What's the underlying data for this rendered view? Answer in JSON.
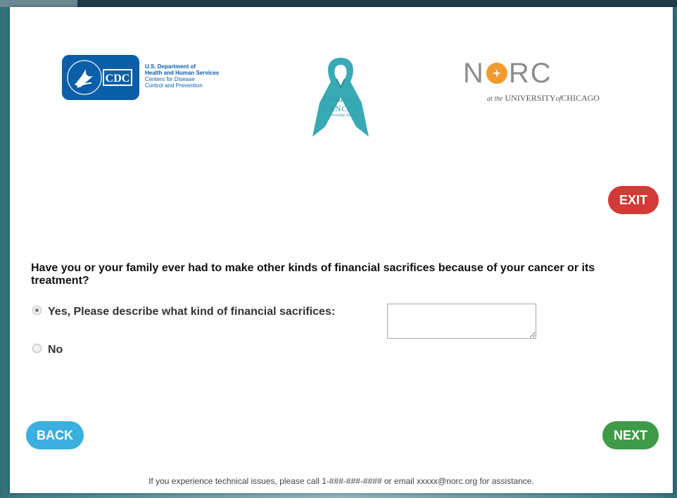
{
  "header": {
    "cdc": {
      "logo_text": "CDC",
      "line1": "U.S. Department of",
      "line2": "Health and Human Services",
      "line3": "Centers for Disease",
      "line4": "Control and Prevention"
    },
    "ribbon": {
      "line1": "Ovarian",
      "line2": "CANCER",
      "line3": "Survivorship Survey",
      "color": "#2f9ea9"
    },
    "norc": {
      "word_left": "N",
      "word_right": "RC",
      "sub_prefix": "at the",
      "sub_university": "UNIVERSITY",
      "sub_of": "of",
      "sub_city": "CHICAGO",
      "accent": "#f29a2e"
    }
  },
  "buttons": {
    "exit": "EXIT",
    "back": "BACK",
    "next": "NEXT",
    "colors": {
      "exit": "#d13a35",
      "back": "#3aafe0",
      "next": "#3f9a47"
    }
  },
  "question": {
    "text": "Have you or your family ever had to make other kinds of financial sacrifices because of your cancer or its treatment?",
    "options": [
      {
        "label": "Yes, Please describe what kind of financial sacrifices:",
        "selected": true
      },
      {
        "label": "No",
        "selected": false
      }
    ],
    "textarea_value": ""
  },
  "footer": {
    "text": "If you experience technical issues, please call 1-###-###-#### or email xxxxx@norc.org for assistance."
  }
}
